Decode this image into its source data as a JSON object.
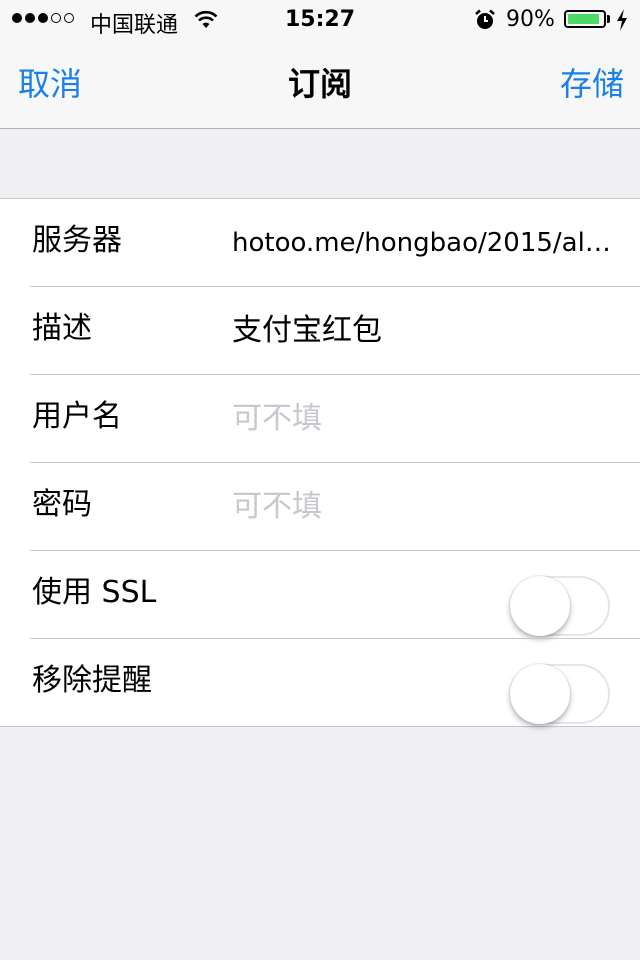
{
  "status_bar": {
    "carrier": "中国联通",
    "time": "15:27",
    "battery_percent": "90%",
    "battery_level": 0.9,
    "battery_color": "#4cd964",
    "signal_strength": 3,
    "icons": [
      "wifi-icon",
      "alarm-icon",
      "battery-icon",
      "charging-icon"
    ]
  },
  "nav": {
    "cancel_label": "取消",
    "title": "订阅",
    "save_label": "存储",
    "accent_color": "#1a7fe6"
  },
  "form": {
    "server": {
      "label": "服务器",
      "value": "hotoo.me/hongbao/2015/al…"
    },
    "description": {
      "label": "描述",
      "value": "支付宝红包"
    },
    "username": {
      "label": "用户名",
      "placeholder": "可不填"
    },
    "password": {
      "label": "密码",
      "placeholder": "可不填"
    },
    "use_ssl": {
      "label": "使用 SSL",
      "on": false
    },
    "remove_alerts": {
      "label": "移除提醒",
      "on": false
    }
  }
}
